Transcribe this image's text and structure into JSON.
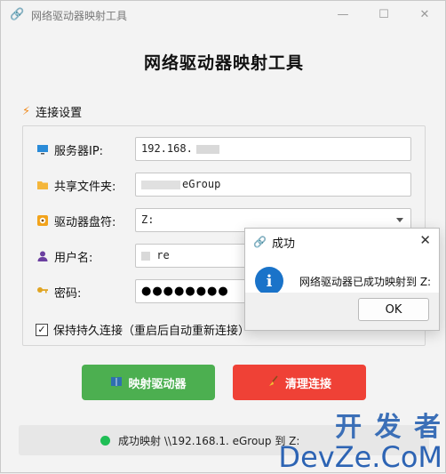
{
  "window": {
    "title": "网络驱动器映射工具",
    "heading": "网络驱动器映射工具",
    "controls": {
      "minimize": "—",
      "maximize": "☐",
      "close": "✕"
    }
  },
  "connection": {
    "group_label": "连接设置",
    "server_ip_label": "服务器IP:",
    "server_ip_value": "192.168.",
    "share_folder_label": "共享文件夹:",
    "share_folder_value": "eGroup",
    "drive_letter_label": "驱动器盘符:",
    "drive_letter_value": "Z:",
    "username_label": "用户名:",
    "username_value": "re",
    "password_label": "密码:",
    "password_value": "●●●●●●●●",
    "persist_label": "保持持久连接（重启后自动重新连接）",
    "persist_checked": true
  },
  "buttons": {
    "map_label": "映射驱动器",
    "clean_label": "清理连接",
    "map_color": "#4caf50",
    "clean_color": "#ef4136"
  },
  "status": {
    "text": "成功映射 \\\\192.168.1.        eGroup 到 Z:",
    "dot_color": "#1fbe55"
  },
  "dialog": {
    "title": "成功",
    "message": "网络驱动器已成功映射到 Z:",
    "ok_label": "OK",
    "close": "✕"
  },
  "watermark": {
    "line1": "开 发 者",
    "line2": "DevZe.CoM"
  }
}
